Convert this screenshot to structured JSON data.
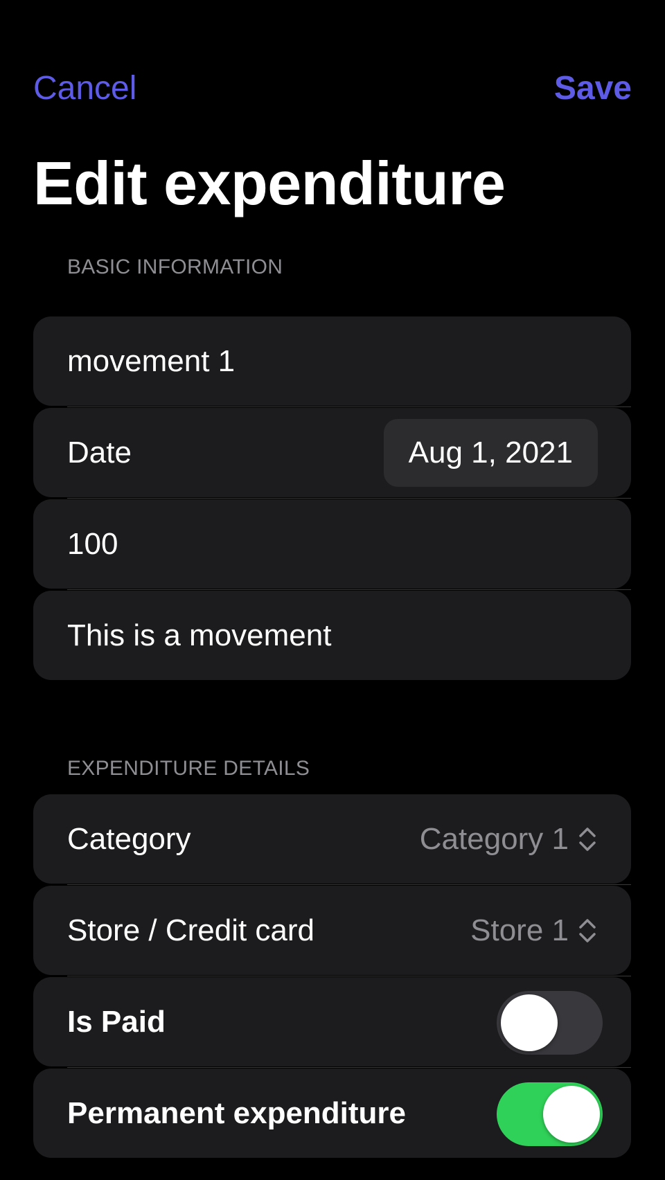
{
  "nav": {
    "cancel_label": "Cancel",
    "save_label": "Save"
  },
  "title": "Edit expenditure",
  "basic_section": {
    "header": "BASIC INFORMATION",
    "name_value": "movement 1",
    "date_label": "Date",
    "date_value": "Aug 1, 2021",
    "amount_value": "100",
    "description_value": "This is a movement"
  },
  "details_section": {
    "header": "EXPENDITURE DETAILS",
    "category_label": "Category",
    "category_value": "Category 1",
    "store_label": "Store / Credit card",
    "store_value": "Store 1",
    "is_paid_label": "Is Paid",
    "is_paid_on": false,
    "permanent_label": "Permanent expenditure",
    "permanent_on": true
  },
  "colors": {
    "accent": "#5E5CE6",
    "toggle_on": "#30D158",
    "toggle_off": "#39393D",
    "row_background": "#1C1C1E",
    "secondary_text": "#8E8E93"
  },
  "icons": {
    "picker": "chevron-up-down-icon"
  }
}
